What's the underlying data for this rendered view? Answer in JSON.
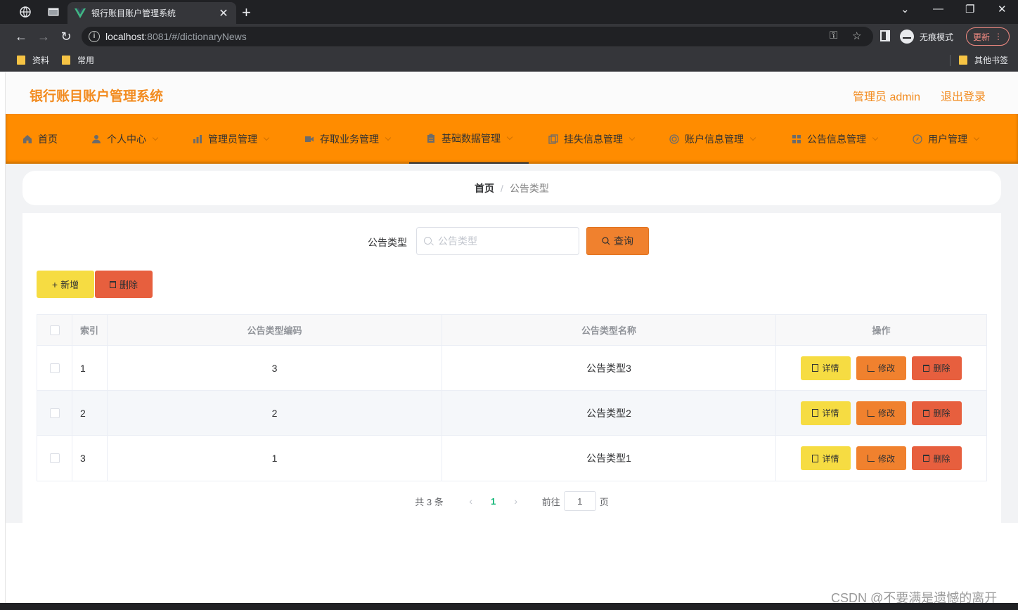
{
  "browser": {
    "tab_title": "银行账目账户管理系统",
    "url_host": "localhost",
    "url_path": ":8081/#/dictionaryNews",
    "incognito_label": "无痕模式",
    "update_label": "更新",
    "bookmarks": [
      "资料",
      "常用"
    ],
    "other_bookmarks": "其他书签"
  },
  "header": {
    "app_title": "银行账目账户管理系统",
    "user_label": "管理员 admin",
    "logout_label": "退出登录",
    "accent_color": "#f28b1f"
  },
  "menu": {
    "items": [
      {
        "label": "首页",
        "icon": "home-icon"
      },
      {
        "label": "个人中心",
        "icon": "user-icon"
      },
      {
        "label": "管理员管理",
        "icon": "bar-chart-icon"
      },
      {
        "label": "存取业务管理",
        "icon": "video-camera-icon"
      },
      {
        "label": "基础数据管理",
        "icon": "clipboard-icon"
      },
      {
        "label": "挂失信息管理",
        "icon": "copy-icon"
      },
      {
        "label": "账户信息管理",
        "icon": "target-icon"
      },
      {
        "label": "公告信息管理",
        "icon": "grid-icon"
      },
      {
        "label": "用户管理",
        "icon": "compass-icon"
      }
    ],
    "active_index": 4,
    "background": "#ff8c00"
  },
  "breadcrumb": {
    "home": "首页",
    "separator": "/",
    "current": "公告类型"
  },
  "search": {
    "label": "公告类型",
    "placeholder": "公告类型",
    "query_button": "查询"
  },
  "actions": {
    "add_button": "新增",
    "delete_button": "删除"
  },
  "table": {
    "columns": [
      "索引",
      "公告类型编码",
      "公告类型名称",
      "操作"
    ],
    "rows": [
      {
        "index": "1",
        "code": "3",
        "name": "公告类型3"
      },
      {
        "index": "2",
        "code": "2",
        "name": "公告类型2"
      },
      {
        "index": "3",
        "code": "1",
        "name": "公告类型1"
      }
    ],
    "row_actions": {
      "detail": "详情",
      "edit": "修改",
      "delete": "删除"
    }
  },
  "pagination": {
    "total_text": "共 3 条",
    "current_page": "1",
    "goto_label": "前往",
    "goto_value": "1",
    "page_suffix": "页"
  },
  "watermark": "CSDN @不要满是遗憾的离开"
}
